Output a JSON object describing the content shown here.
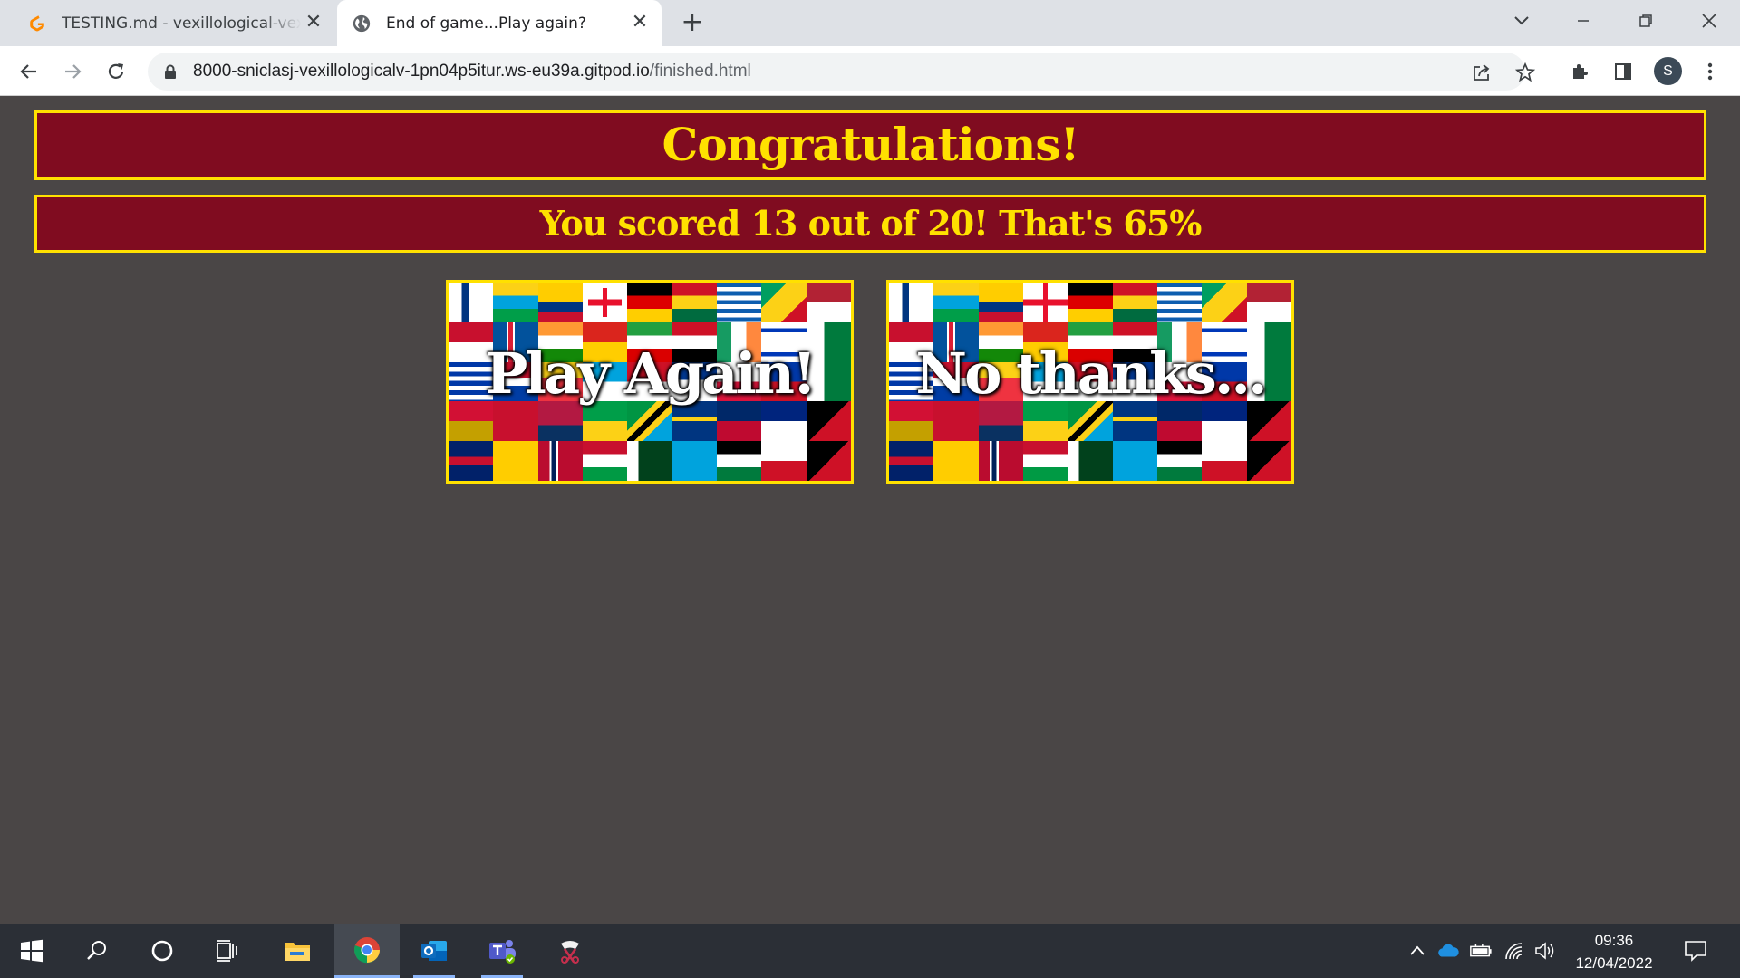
{
  "browser": {
    "tabs": [
      {
        "title": "TESTING.md - vexillological-vexations",
        "close": "✕",
        "icon": "gitpod-icon"
      },
      {
        "title": "End of game...Play again?",
        "close": "✕",
        "icon": "globe-icon"
      }
    ],
    "new_tab": "+",
    "url_host": "8000-sniclasj-vexillologicalv-1pn04p5itur.ws-eu39a.gitpod.io",
    "url_path": "/finished.html",
    "profile_initial": "S"
  },
  "page": {
    "heading": "Congratulations!",
    "score_text": "You scored 13 out of 20! That's 65%",
    "buttons": {
      "play_again": "Play Again!",
      "no_thanks": "No thanks..."
    },
    "colors": {
      "background": "#4a4646",
      "banner": "#800c20",
      "accent": "#ffe100"
    }
  },
  "taskbar": {
    "time": "09:36",
    "date": "12/04/2022",
    "apps": [
      "start-icon",
      "search-icon",
      "cortana-icon",
      "task-view-icon",
      "file-explorer-icon",
      "chrome-icon",
      "outlook-icon",
      "teams-icon",
      "snip-icon"
    ]
  }
}
